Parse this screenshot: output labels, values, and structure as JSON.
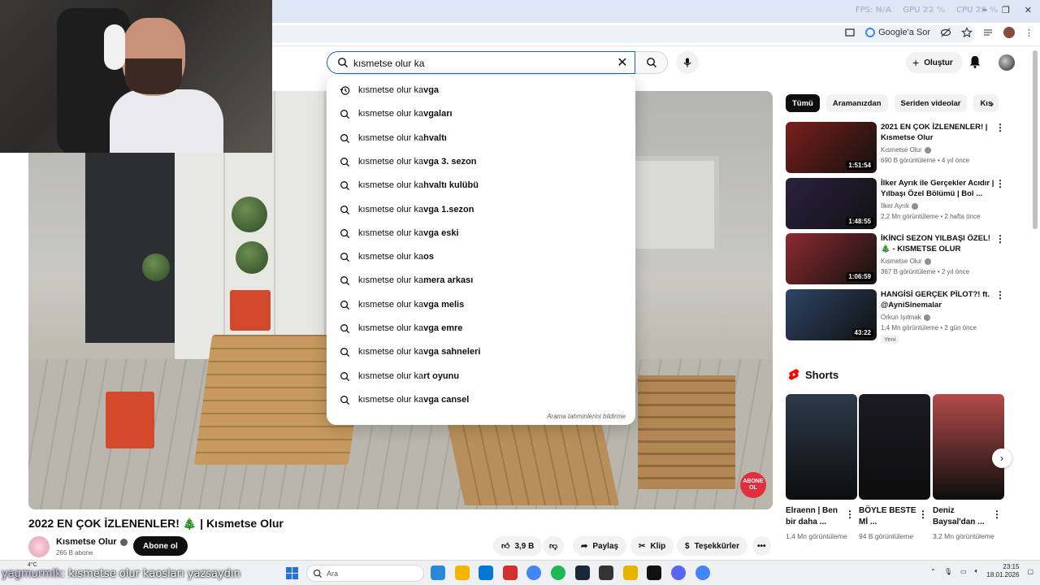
{
  "browser": {
    "stats": [
      {
        "label": "FPS:",
        "value": "N/A"
      },
      {
        "label": "GPU",
        "value": "22 %"
      },
      {
        "label": "CPU",
        "value": "25 %"
      }
    ],
    "google_ask": "Google'a Sor"
  },
  "header": {
    "search_value": "kısmetse olur ka",
    "create_label": "Oluştur"
  },
  "suggestions": {
    "typed_prefix": "kısmetse olur ka",
    "items": [
      {
        "rest": "vga",
        "history": true
      },
      {
        "rest": "vgaları",
        "history": false
      },
      {
        "rest": "hvaltı",
        "history": false
      },
      {
        "rest": "vga 3. sezon",
        "history": false
      },
      {
        "rest": "hvaltı kulübü",
        "history": false
      },
      {
        "rest": "vga 1.sezon",
        "history": false
      },
      {
        "rest": "vga eski",
        "history": false
      },
      {
        "rest": "os",
        "history": false
      },
      {
        "rest": "mera arkası",
        "history": false
      },
      {
        "rest": "vga melis",
        "history": false
      },
      {
        "rest": "vga emre",
        "history": false
      },
      {
        "rest": "vga sahneleri",
        "history": false
      },
      {
        "rest": "rt oyunu",
        "history": false
      },
      {
        "rest": "vga cansel",
        "history": false
      }
    ],
    "report": "Arama tahminlerini bildirme"
  },
  "player": {
    "logo_text": "ABONE OL"
  },
  "video": {
    "title": "2022 EN ÇOK İZLENENLER! 🎄 | Kısmetse Olur",
    "channel": "Kısmetse Olur",
    "subscribers": "265 B abone",
    "subscribe_label": "Abone ol",
    "likes": "3,9 B",
    "share": "Paylaş",
    "clip": "Klip",
    "thanks": "Teşekkürler",
    "more": "•••"
  },
  "chips": [
    "Tümü",
    "Aramanızdan",
    "Seriden videolar",
    "Kıs"
  ],
  "recommendations": [
    {
      "title": "2021 EN ÇOK İZLENENLER! | Kısmetse Olur",
      "channel": "Kısmetse Olur",
      "meta": "690 B görüntüleme • 4 yıl önce",
      "duration": "1:51:54",
      "badge": "",
      "thumb": "#7a1f1a"
    },
    {
      "title": "İlker Ayrık ile Gerçekler Acıdır | Yılbaşı Özel Bölümü | Bol ...",
      "channel": "İlker Ayrık",
      "meta": "2,2 Mn görüntüleme • 2 hafta önce",
      "duration": "1:48:55",
      "badge": "",
      "thumb": "#2a2140"
    },
    {
      "title": "İKİNCİ SEZON YILBAŞI ÖZEL! 🎄 - KISMETSE OLUR",
      "channel": "Kısmetse Olur",
      "meta": "367 B görüntüleme • 2 yıl önce",
      "duration": "1:06:59",
      "badge": "",
      "thumb": "#8d2a2f"
    },
    {
      "title": "HANGİSİ GERÇEK PİLOT?! ft. @AyniSinemalar",
      "channel": "Orkun Işıtmak",
      "meta": "1,4 Mn görüntüleme • 2 gün önce",
      "duration": "43:22",
      "badge": "Yeni",
      "thumb": "#2d4466"
    }
  ],
  "shorts": {
    "heading": "Shorts",
    "items": [
      {
        "title": "Elraenn | Ben bir daha ...",
        "views": "1,4 Mn görüntüleme",
        "thumb": "#2c3a4a"
      },
      {
        "title": "BÖYLE BESTE Mİ ...",
        "views": "94 B görüntüleme",
        "thumb": "#1a1a22"
      },
      {
        "title": "Deniz Baysal'dan ...",
        "views": "3,2 Mn görüntüleme",
        "thumb": "#b44b4b"
      }
    ]
  },
  "taskbar": {
    "weather": "4°C",
    "chat_user": "yagmurmlk",
    "chat_message": ": kısmetse olur kaosları yazsaydın",
    "search_placeholder": "Ara",
    "time": "23:15",
    "date": "18.01.2026",
    "app_colors": [
      "#2b88d8",
      "#f4b400",
      "#0078d4",
      "#d32f2f",
      "#4285f4",
      "#1db954",
      "#1b2838",
      "#333",
      "#e6b400",
      "#111",
      "#5865f2",
      "#4285f4"
    ]
  }
}
